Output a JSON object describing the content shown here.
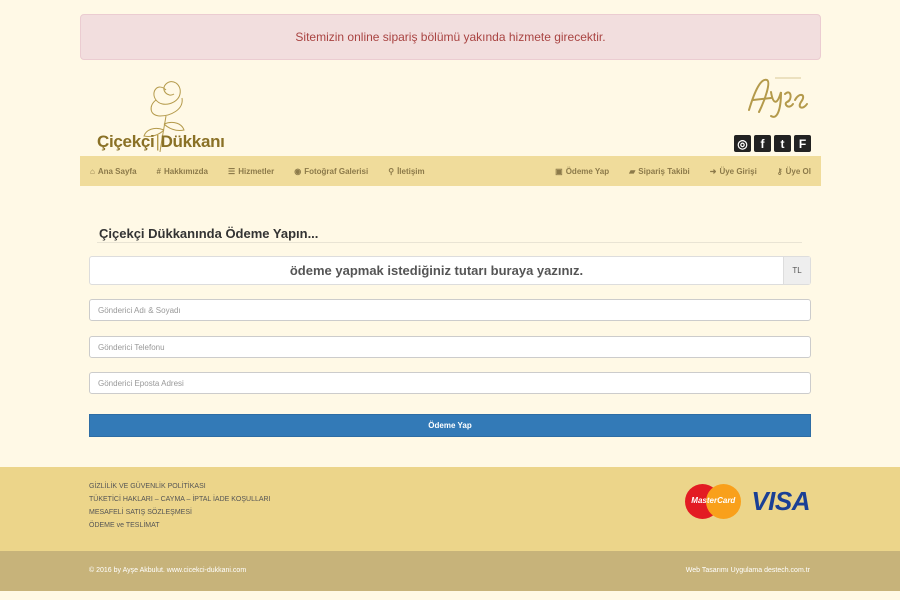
{
  "alert": {
    "message": "Sitemizin online sipariş bölümü yakında hizmete girecektir."
  },
  "brand": {
    "name_left": "Çiçekçi",
    "name_right": "Dükkanı",
    "logo_icon": "rose-icon",
    "signature_icon": "design-by-ayse-signature"
  },
  "social": [
    {
      "icon": "instagram-icon",
      "glyph": "◎"
    },
    {
      "icon": "facebook-icon",
      "glyph": "f"
    },
    {
      "icon": "twitter-icon",
      "glyph": "t"
    },
    {
      "icon": "foursquare-icon",
      "glyph": "F"
    }
  ],
  "nav": {
    "left": [
      {
        "label": "Ana Sayfa",
        "icon": "home-icon",
        "glyph": "⌂"
      },
      {
        "label": "Hakkımızda",
        "icon": "hash-icon",
        "glyph": "#"
      },
      {
        "label": "Hizmetler",
        "icon": "list-icon",
        "glyph": "☰"
      },
      {
        "label": "Fotoğraf Galerisi",
        "icon": "eye-icon",
        "glyph": "◉"
      },
      {
        "label": "İletişim",
        "icon": "map-marker-icon",
        "glyph": "⚲"
      }
    ],
    "right": [
      {
        "label": "Ödeme Yap",
        "icon": "shopping-bag-icon",
        "glyph": "▣"
      },
      {
        "label": "Sipariş Takibi",
        "icon": "truck-icon",
        "glyph": "▰"
      },
      {
        "label": "Üye Girişi",
        "icon": "sign-in-icon",
        "glyph": "➜"
      },
      {
        "label": "Üye Ol",
        "icon": "key-icon",
        "glyph": "⚷"
      }
    ]
  },
  "form": {
    "title": "Çiçekçi Dükkanında Ödeme Yapın...",
    "amount_placeholder": "ödeme yapmak istediğiniz tutarı buraya yazınız.",
    "currency": "TL",
    "sender_name_placeholder": "Gönderici Adı & Soyadı",
    "sender_phone_placeholder": "Gönderici Telefonu",
    "sender_email_placeholder": "Gönderici Eposta Adresi",
    "submit_label": "Ödeme Yap"
  },
  "footer": {
    "links": [
      "GİZLİLİK VE GÜVENLİK POLİTİKASI",
      "TÜKETİCİ HAKLARI – CAYMA – İPTAL İADE KOŞULLARI",
      "MESAFELİ SATIŞ SÖZLEŞMESİ",
      "ÖDEME ve TESLİMAT"
    ],
    "mastercard_text": "MasterCard",
    "visa_text": "VISA",
    "copyright": "© 2016 by Ayşe Akbulut. www.cicekci-dukkani.com",
    "credit": "Web Tasarımı Uygulama destech.com.tr"
  }
}
